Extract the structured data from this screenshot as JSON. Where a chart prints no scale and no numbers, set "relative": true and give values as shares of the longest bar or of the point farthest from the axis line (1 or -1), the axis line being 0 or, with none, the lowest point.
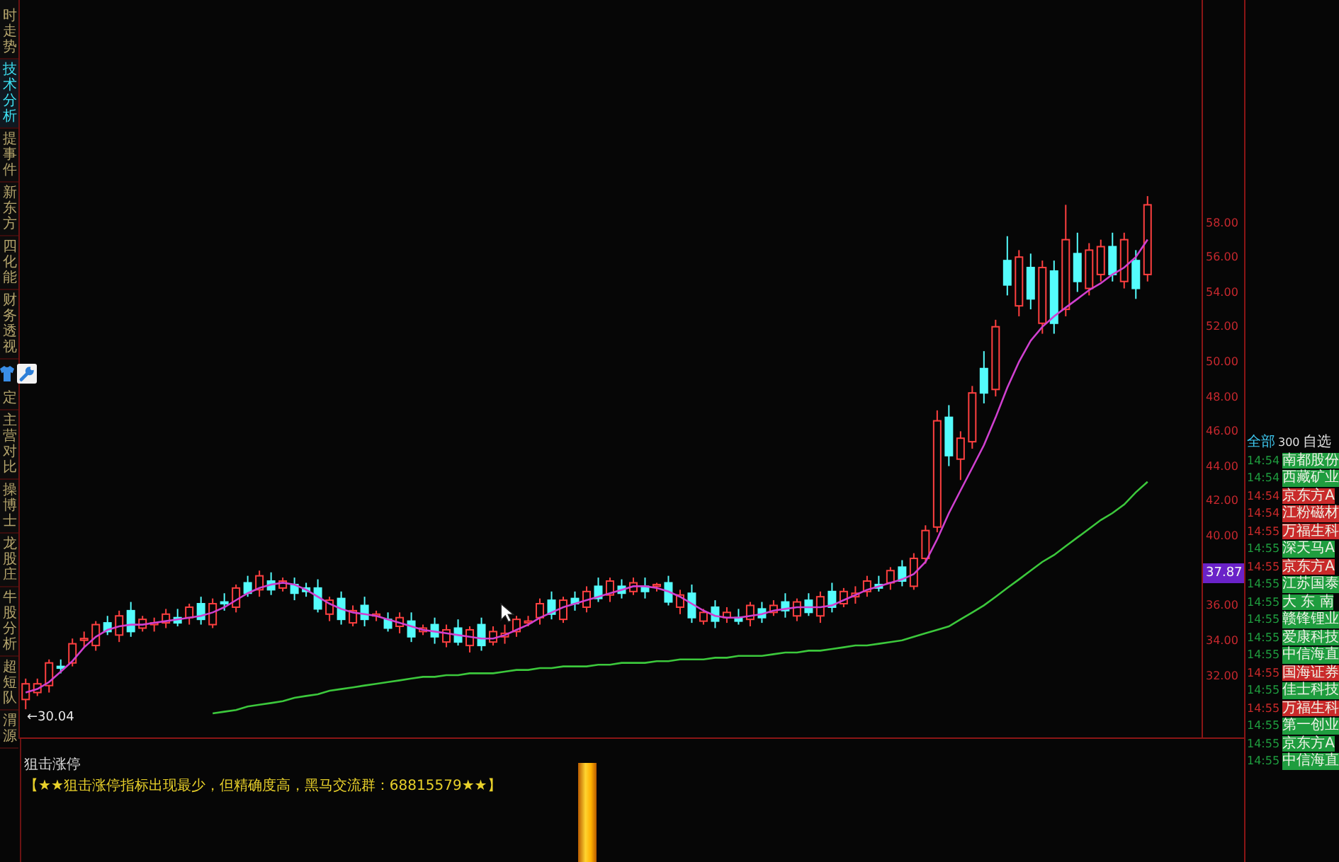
{
  "sidebar": {
    "upper_tabs": [
      {
        "label": "时走势",
        "selected": false
      },
      {
        "label": "技术分析",
        "selected": true
      },
      {
        "label": "提事件",
        "selected": false
      },
      {
        "label": "新东方",
        "selected": false
      },
      {
        "label": "四化能",
        "selected": false
      },
      {
        "label": "财务透视",
        "selected": false
      }
    ],
    "lower_tabs": [
      {
        "label": "定",
        "selected": false
      },
      {
        "label": "主营对比",
        "selected": false
      },
      {
        "label": "操博士",
        "selected": false
      },
      {
        "label": "龙股庄",
        "selected": false
      },
      {
        "label": "牛股分析",
        "selected": false
      },
      {
        "label": "超短队",
        "selected": false
      },
      {
        "label": "渭源",
        "selected": false
      }
    ]
  },
  "price_chart": {
    "current_price": "37.87",
    "low_marker": "←30.04",
    "chart_data": {
      "type": "candlestick",
      "ylim": [
        28.34,
        70.76
      ],
      "yticks": [
        {
          "value": 58,
          "label": "58.00"
        },
        {
          "value": 56,
          "label": "56.00"
        },
        {
          "value": 54,
          "label": "54.00"
        },
        {
          "value": 52,
          "label": "52.00"
        },
        {
          "value": 50,
          "label": "50.00"
        },
        {
          "value": 48,
          "label": "48.00"
        },
        {
          "value": 46,
          "label": "46.00"
        },
        {
          "value": 44,
          "label": "44.00"
        },
        {
          "value": 42,
          "label": "42.00"
        },
        {
          "value": 40,
          "label": "40.00"
        },
        {
          "value": 36,
          "label": "36.00"
        },
        {
          "value": 34,
          "label": "34.00"
        },
        {
          "value": 32,
          "label": "32.00"
        }
      ],
      "ohlc": [
        [
          30.6,
          31.8,
          30.04,
          31.5
        ],
        [
          31.0,
          31.8,
          30.8,
          31.5
        ],
        [
          31.4,
          32.9,
          31.0,
          32.7
        ],
        [
          32.5,
          32.9,
          32.1,
          32.4
        ],
        [
          32.7,
          34.1,
          32.5,
          33.8
        ],
        [
          34.0,
          34.5,
          33.6,
          34.1
        ],
        [
          33.7,
          35.1,
          33.4,
          34.9
        ],
        [
          35.0,
          35.4,
          34.3,
          34.5
        ],
        [
          34.3,
          35.7,
          33.9,
          35.4
        ],
        [
          35.7,
          36.2,
          34.2,
          34.5
        ],
        [
          34.7,
          35.4,
          34.5,
          35.2
        ],
        [
          34.9,
          35.3,
          34.5,
          35.0
        ],
        [
          35.0,
          35.8,
          34.7,
          35.5
        ],
        [
          35.3,
          35.8,
          34.8,
          35.0
        ],
        [
          35.3,
          36.1,
          34.9,
          35.9
        ],
        [
          36.1,
          36.5,
          34.9,
          35.2
        ],
        [
          34.9,
          36.4,
          34.7,
          36.1
        ],
        [
          36.2,
          36.7,
          35.7,
          36.1
        ],
        [
          35.9,
          37.2,
          35.6,
          37.0
        ],
        [
          37.3,
          37.7,
          36.5,
          36.7
        ],
        [
          36.9,
          38.0,
          36.5,
          37.7
        ],
        [
          37.4,
          37.9,
          36.6,
          36.9
        ],
        [
          37.0,
          37.6,
          36.8,
          37.4
        ],
        [
          37.2,
          37.6,
          36.3,
          36.7
        ],
        [
          37.0,
          37.3,
          36.5,
          36.8
        ],
        [
          37.0,
          37.5,
          35.6,
          35.8
        ],
        [
          35.5,
          36.5,
          35.1,
          36.3
        ],
        [
          36.4,
          36.8,
          34.9,
          35.2
        ],
        [
          35.0,
          36.0,
          34.8,
          35.7
        ],
        [
          36.0,
          36.5,
          34.8,
          35.2
        ],
        [
          35.4,
          35.7,
          35.1,
          35.5
        ],
        [
          35.2,
          35.6,
          34.5,
          34.7
        ],
        [
          34.8,
          35.6,
          34.4,
          35.3
        ],
        [
          35.1,
          35.6,
          33.9,
          34.2
        ],
        [
          34.5,
          34.9,
          34.3,
          34.7
        ],
        [
          34.9,
          35.3,
          33.8,
          34.2
        ],
        [
          33.9,
          34.9,
          33.6,
          34.6
        ],
        [
          34.7,
          35.2,
          33.7,
          33.9
        ],
        [
          33.7,
          34.8,
          33.3,
          34.6
        ],
        [
          34.9,
          35.3,
          33.4,
          33.7
        ],
        [
          33.9,
          34.8,
          33.7,
          34.5
        ],
        [
          34.2,
          34.9,
          33.8,
          34.4
        ],
        [
          34.5,
          35.4,
          34.2,
          35.2
        ],
        [
          35.0,
          35.4,
          34.8,
          35.1
        ],
        [
          35.3,
          36.4,
          34.9,
          36.1
        ],
        [
          36.3,
          36.8,
          35.2,
          35.5
        ],
        [
          35.2,
          36.5,
          35.0,
          36.3
        ],
        [
          36.4,
          36.8,
          35.7,
          36.1
        ],
        [
          35.9,
          37.1,
          35.6,
          36.8
        ],
        [
          37.1,
          37.6,
          36.2,
          36.4
        ],
        [
          36.6,
          37.6,
          36.2,
          37.4
        ],
        [
          37.1,
          37.5,
          36.4,
          36.7
        ],
        [
          36.8,
          37.6,
          36.6,
          37.3
        ],
        [
          37.1,
          37.6,
          36.4,
          36.8
        ],
        [
          37.1,
          37.3,
          36.8,
          37.2
        ],
        [
          37.3,
          37.7,
          36.0,
          36.2
        ],
        [
          35.9,
          36.9,
          35.5,
          36.6
        ],
        [
          36.7,
          37.2,
          35.0,
          35.3
        ],
        [
          35.1,
          35.8,
          34.9,
          35.6
        ],
        [
          35.9,
          36.3,
          34.7,
          35.1
        ],
        [
          35.3,
          35.9,
          35.0,
          35.6
        ],
        [
          35.3,
          35.8,
          34.9,
          35.1
        ],
        [
          35.2,
          36.2,
          34.8,
          36.0
        ],
        [
          35.8,
          36.2,
          35.0,
          35.3
        ],
        [
          35.6,
          36.3,
          35.4,
          36.0
        ],
        [
          36.2,
          36.7,
          35.3,
          35.7
        ],
        [
          35.4,
          36.4,
          35.1,
          36.2
        ],
        [
          36.3,
          36.7,
          35.4,
          35.6
        ],
        [
          35.4,
          36.8,
          35.0,
          36.5
        ],
        [
          36.8,
          37.3,
          35.6,
          35.9
        ],
        [
          36.1,
          37.0,
          35.9,
          36.8
        ],
        [
          36.5,
          37.1,
          36.1,
          36.7
        ],
        [
          36.8,
          37.7,
          36.5,
          37.4
        ],
        [
          37.2,
          37.7,
          36.8,
          37.0
        ],
        [
          37.3,
          38.2,
          36.9,
          38.0
        ],
        [
          38.2,
          38.6,
          37.1,
          37.4
        ],
        [
          37.1,
          39.0,
          36.9,
          38.7
        ],
        [
          38.7,
          40.6,
          38.4,
          40.3
        ],
        [
          40.5,
          47.2,
          40.2,
          46.6
        ],
        [
          46.8,
          47.5,
          44.0,
          44.6
        ],
        [
          44.4,
          46.0,
          43.2,
          45.6
        ],
        [
          45.4,
          48.6,
          45.0,
          48.2
        ],
        [
          49.6,
          50.6,
          47.6,
          48.2
        ],
        [
          48.4,
          52.4,
          48.0,
          52.0
        ],
        [
          55.8,
          57.2,
          53.8,
          54.4
        ],
        [
          53.2,
          56.4,
          52.6,
          56.0
        ],
        [
          55.4,
          56.2,
          53.0,
          53.6
        ],
        [
          52.2,
          55.8,
          51.6,
          55.4
        ],
        [
          55.2,
          55.8,
          51.6,
          52.2
        ],
        [
          53.0,
          59.0,
          52.6,
          57.0
        ],
        [
          56.2,
          57.4,
          54.0,
          54.6
        ],
        [
          54.2,
          56.8,
          53.8,
          56.4
        ],
        [
          55.0,
          57.0,
          54.6,
          56.6
        ],
        [
          56.6,
          57.4,
          54.6,
          55.0
        ],
        [
          54.6,
          57.4,
          54.2,
          57.0
        ],
        [
          55.8,
          56.4,
          53.6,
          54.2
        ],
        [
          55.0,
          59.5,
          54.6,
          59.0
        ]
      ]
    },
    "moving_averages": {
      "chart_data": {
        "type": "line",
        "relative": true,
        "ylim": [
          28.34,
          70.76
        ],
        "series": [
          {
            "color": "#d040d0",
            "values": [
              31.0,
              31.2,
              31.6,
              32.2,
              32.8,
              33.6,
              34.2,
              34.6,
              34.8,
              34.9,
              34.9,
              35.0,
              35.1,
              35.2,
              35.3,
              35.4,
              35.6,
              35.9,
              36.3,
              36.7,
              37.0,
              37.2,
              37.3,
              37.2,
              36.9,
              36.5,
              36.1,
              35.8,
              35.6,
              35.5,
              35.4,
              35.2,
              35.0,
              34.8,
              34.6,
              34.5,
              34.4,
              34.3,
              34.2,
              34.1,
              34.1,
              34.3,
              34.6,
              34.9,
              35.3,
              35.6,
              35.9,
              36.1,
              36.3,
              36.5,
              36.7,
              36.9,
              37.1,
              37.1,
              37.0,
              36.8,
              36.5,
              36.1,
              35.7,
              35.4,
              35.3,
              35.3,
              35.4,
              35.5,
              35.7,
              35.8,
              35.9,
              35.9,
              35.9,
              36.0,
              36.3,
              36.6,
              36.9,
              37.1,
              37.3,
              37.5,
              37.8,
              38.5,
              39.8,
              41.3,
              42.6,
              43.9,
              45.2,
              46.8,
              48.5,
              50.0,
              51.2,
              52.0,
              52.6,
              53.1,
              53.6,
              54.1,
              54.5,
              55.0,
              55.4,
              56.0,
              57.0
            ]
          },
          {
            "color": "#3cc83c",
            "values": [
              null,
              null,
              null,
              null,
              null,
              null,
              null,
              null,
              null,
              null,
              null,
              null,
              null,
              null,
              null,
              null,
              29.8,
              29.9,
              30.0,
              30.2,
              30.3,
              30.4,
              30.5,
              30.7,
              30.8,
              30.9,
              31.1,
              31.2,
              31.3,
              31.4,
              31.5,
              31.6,
              31.7,
              31.8,
              31.9,
              31.9,
              32.0,
              32.0,
              32.1,
              32.1,
              32.1,
              32.2,
              32.3,
              32.3,
              32.4,
              32.4,
              32.5,
              32.5,
              32.5,
              32.6,
              32.6,
              32.7,
              32.7,
              32.7,
              32.8,
              32.8,
              32.9,
              32.9,
              32.9,
              33.0,
              33.0,
              33.1,
              33.1,
              33.1,
              33.2,
              33.3,
              33.3,
              33.4,
              33.4,
              33.5,
              33.6,
              33.7,
              33.7,
              33.8,
              33.9,
              34.0,
              34.2,
              34.4,
              34.6,
              34.8,
              35.2,
              35.6,
              36.0,
              36.5,
              37.0,
              37.5,
              38.0,
              38.5,
              38.9,
              39.4,
              39.9,
              40.4,
              40.9,
              41.3,
              41.8,
              42.5,
              43.1
            ]
          }
        ]
      }
    }
  },
  "indicator_panel": {
    "title": "狙击涨停",
    "note": "【★★狙击涨停指标出现最少，但精确度高，黑马交流群：68815579★★】"
  },
  "quote_list": {
    "tabs": [
      {
        "label": "全部",
        "selected": true,
        "count": "300"
      },
      {
        "label": "自选",
        "selected": false
      }
    ],
    "rows": [
      {
        "time": "14:54",
        "name": "南都股份",
        "color": "#1f9d3f"
      },
      {
        "time": "14:54",
        "name": "西藏矿业",
        "color": "#1f9d3f"
      },
      {
        "time": "14:54",
        "name": "京东方A",
        "color": "#c92a2a"
      },
      {
        "time": "14:54",
        "name": "江粉磁材",
        "color": "#c92a2a"
      },
      {
        "time": "14:55",
        "name": "万福生科",
        "color": "#c92a2a"
      },
      {
        "time": "14:55",
        "name": "深天马A",
        "color": "#1f9d3f"
      },
      {
        "time": "14:55",
        "name": "京东方A",
        "color": "#c92a2a"
      },
      {
        "time": "14:55",
        "name": "江苏国泰",
        "color": "#1f9d3f"
      },
      {
        "time": "14:55",
        "name": "大 东 南",
        "color": "#1f9d3f"
      },
      {
        "time": "14:55",
        "name": "赣锋锂业",
        "color": "#1f9d3f"
      },
      {
        "time": "14:55",
        "name": "爱康科技",
        "color": "#1f9d3f"
      },
      {
        "time": "14:55",
        "name": "中信海直",
        "color": "#1f9d3f"
      },
      {
        "time": "14:55",
        "name": "国海证券",
        "color": "#c92a2a"
      },
      {
        "time": "14:55",
        "name": "佳士科技",
        "color": "#1f9d3f"
      },
      {
        "time": "14:55",
        "name": "万福生科",
        "color": "#c92a2a"
      },
      {
        "time": "14:55",
        "name": "第一创业",
        "color": "#1f9d3f"
      },
      {
        "time": "14:55",
        "name": "京东方A",
        "color": "#1f9d3f"
      },
      {
        "time": "14:55",
        "name": "中信海直",
        "color": "#1f9d3f"
      }
    ]
  }
}
